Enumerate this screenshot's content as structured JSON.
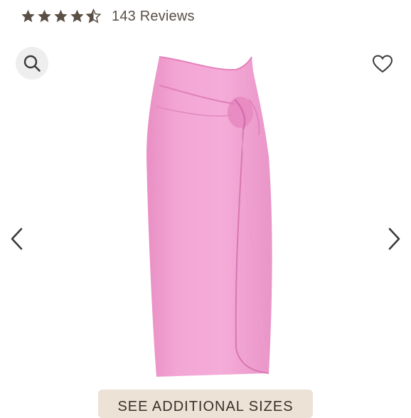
{
  "rating": {
    "stars_value": 4.5,
    "stars_max": 5,
    "reviews_label": "143 Reviews"
  },
  "gallery": {
    "zoom_icon": "search-icon",
    "favorite_icon": "heart-outline-icon",
    "prev_icon": "chevron-left-icon",
    "next_icon": "chevron-right-icon",
    "product_color": "#f2a3d2"
  },
  "cta": {
    "sizes_label": "SEE ADDITIONAL SIZES"
  },
  "colors": {
    "text": "#5a4f45",
    "zoom_bg": "#eeeeee",
    "button_bg": "#ece2d6"
  }
}
